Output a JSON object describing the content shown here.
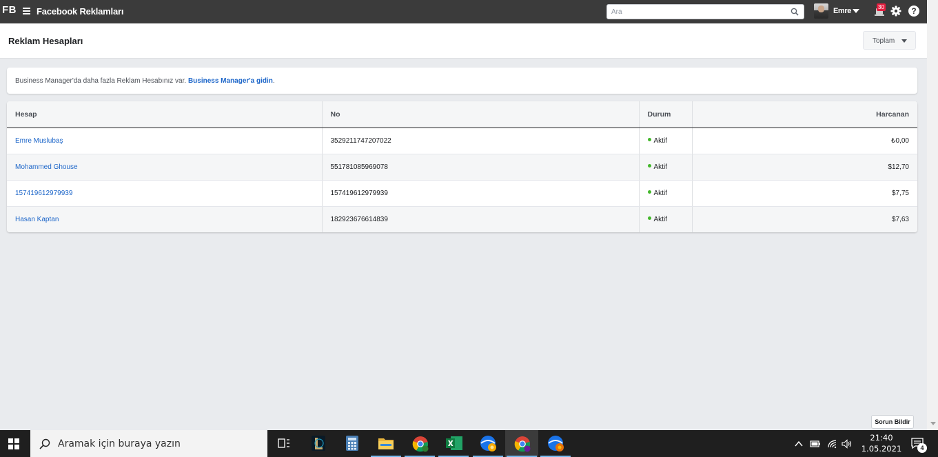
{
  "topbar": {
    "logo": "FB",
    "app_title": "Facebook Reklamları",
    "search_placeholder": "Ara",
    "user_name": "Emre",
    "notification_count": "30"
  },
  "page": {
    "title": "Reklam Hesapları",
    "total_button": "Toplam"
  },
  "banner": {
    "text": "Business Manager'da daha fazla Reklam Hesabınız var. ",
    "link": "Business Manager'a gidin",
    "suffix": "."
  },
  "table": {
    "headers": {
      "account": "Hesap",
      "id": "No",
      "status": "Durum",
      "spent": "Harcanan"
    },
    "rows": [
      {
        "account": "Emre Muslubaş",
        "id": "3529211747207022",
        "status": "Aktif",
        "spent": "₺0,00"
      },
      {
        "account": "Mohammed Ghouse",
        "id": "551781085969078",
        "status": "Aktif",
        "spent": "$12,70"
      },
      {
        "account": "157419612979939",
        "id": "157419612979939",
        "status": "Aktif",
        "spent": "$7,75"
      },
      {
        "account": "Hasan Kaptan",
        "id": "182923676614839",
        "status": "Aktif",
        "spent": "$7,63"
      }
    ]
  },
  "feedback_button": "Sorun Bildir",
  "taskbar": {
    "search_placeholder": "Aramak için buraya yazın",
    "time": "21:40",
    "date": "1.05.2021",
    "notification_count": "4"
  },
  "colors": {
    "topbar": "#3b3b3b",
    "link": "#1d66c9",
    "status_active": "#42b72a",
    "badge": "#e41e3f"
  }
}
